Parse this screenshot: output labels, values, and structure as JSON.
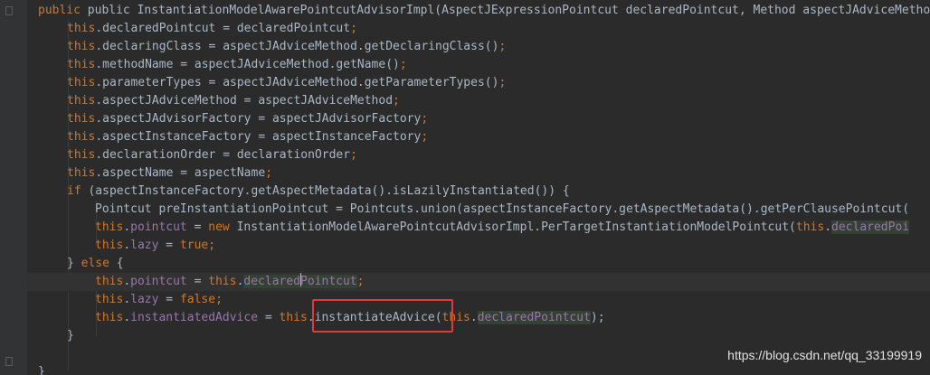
{
  "code": {
    "line1_sig": "public InstantiationModelAwarePointcutAdvisorImpl(AspectJExpressionPointcut declaredPointcut, Method aspectJAdviceMethod, As",
    "l2": "declaredPointcut = declaredPointcut",
    "l3": "declaringClass = aspectJAdviceMethod.getDeclaringClass()",
    "l4": "methodName = aspectJAdviceMethod.getName()",
    "l5": "parameterTypes = aspectJAdviceMethod.getParameterTypes()",
    "l6": "aspectJAdviceMethod = aspectJAdviceMethod",
    "l7": "aspectJAdvisorFactory = aspectJAdvisorFactory",
    "l8": "aspectInstanceFactory = aspectInstanceFactory",
    "l9": "declarationOrder = declarationOrder",
    "l10": "aspectName = aspectName",
    "l11_rest": "(aspectInstanceFactory.getAspectMetadata().isLazilyInstantiated()) {",
    "l12": "Pointcut preInstantiationPointcut = Pointcuts.union(aspectInstanceFactory.getAspectMetadata().getPerClausePointcut(",
    "l13_mid": "InstantiationModelAwarePointcutAdvisorImpl.PerTargetInstantiationModelPointcut(",
    "l13_end": "declaredPoi",
    "l16_a": "declared",
    "l16_b": "Pointcut",
    "l18_mid": "instantiateAdvice(",
    "l18_end": "declaredPointcut"
  },
  "keywords": {
    "this": "this",
    "public": "public",
    "if": "if",
    "else": "else",
    "new": "new",
    "true": "true",
    "false": "false"
  },
  "fields": {
    "pointcut": "pointcut",
    "lazy": "lazy",
    "instantiatedAdvice": "instantiatedAdvice"
  },
  "watermark": "https://blog.csdn.net/qq_33199919"
}
